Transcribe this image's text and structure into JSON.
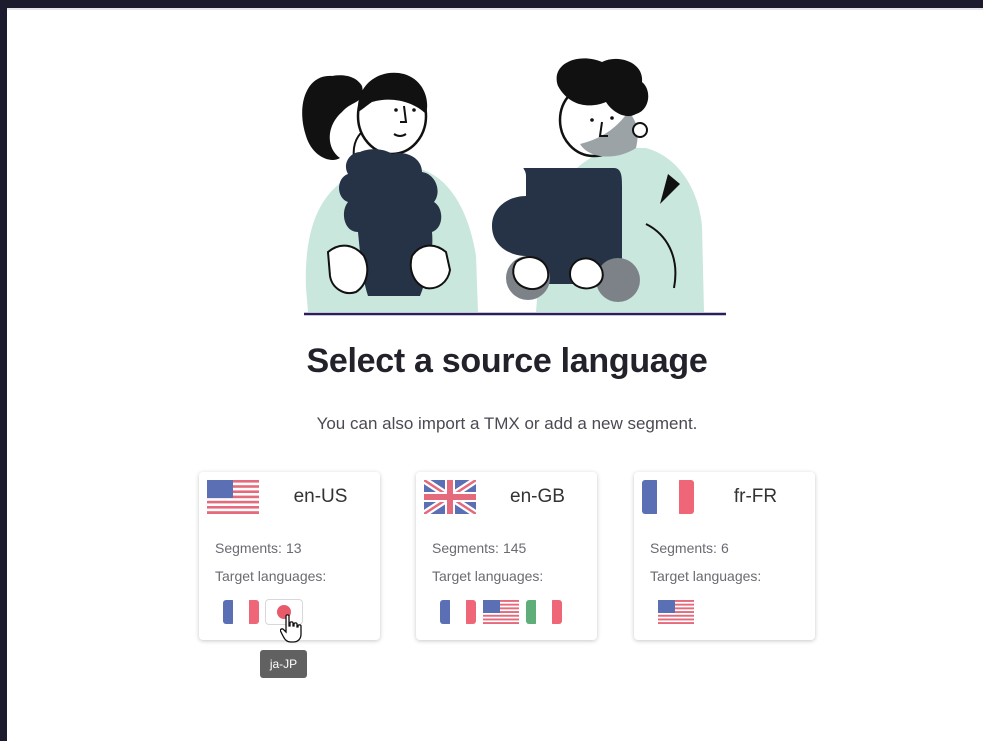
{
  "page": {
    "title": "Select a source language",
    "subtitle": "You can also import a TMX or add a new segment."
  },
  "labels": {
    "segments": "Segments:",
    "target_languages": "Target languages:"
  },
  "cards": [
    {
      "code": "en-US",
      "flag_icon": "us-flag-icon",
      "segments": "13",
      "targets": [
        "fr-flag-icon",
        "jp-flag-icon"
      ]
    },
    {
      "code": "en-GB",
      "flag_icon": "gb-flag-icon",
      "segments": "145",
      "targets": [
        "fr-flag-icon",
        "us-flag-icon",
        "it-flag-icon"
      ]
    },
    {
      "code": "fr-FR",
      "flag_icon": "fr-flag-icon",
      "segments": "6",
      "targets": [
        "us-flag-icon"
      ]
    }
  ],
  "tooltip": {
    "text": "ja-JP"
  },
  "colors": {
    "accent": "#2a1f5c",
    "illustration_dark": "#263347",
    "illustration_mint": "#c9e7dd"
  }
}
